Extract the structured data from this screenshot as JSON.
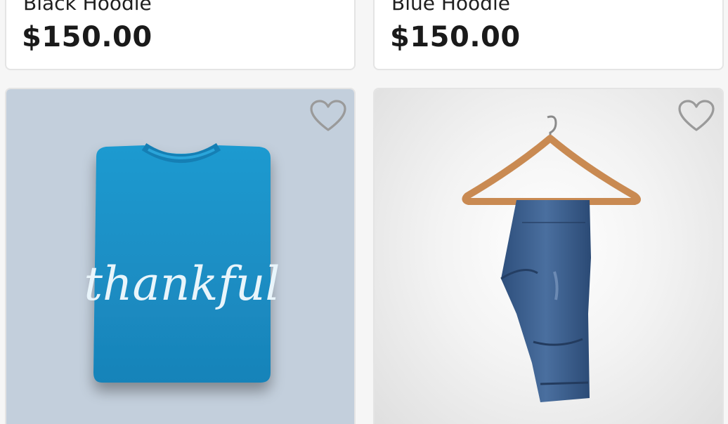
{
  "products": [
    {
      "name": "Black Hoodie",
      "price": "$150.00"
    },
    {
      "name": "Blue Hoodie",
      "price": "$150.00"
    },
    {
      "image_icon": "folded-tshirt-icon",
      "print_text": "thankful",
      "favorite_icon": "heart-outline-icon"
    },
    {
      "image_icon": "jeans-on-hanger-icon",
      "favorite_icon": "heart-outline-icon"
    }
  ],
  "colors": {
    "tshirt": "#1a8fc4",
    "tshirt_bg": "#c3cfdc",
    "jeans": "#3b5f8e",
    "hanger": "#c98a52",
    "heart_stroke": "#9a9a9a"
  }
}
